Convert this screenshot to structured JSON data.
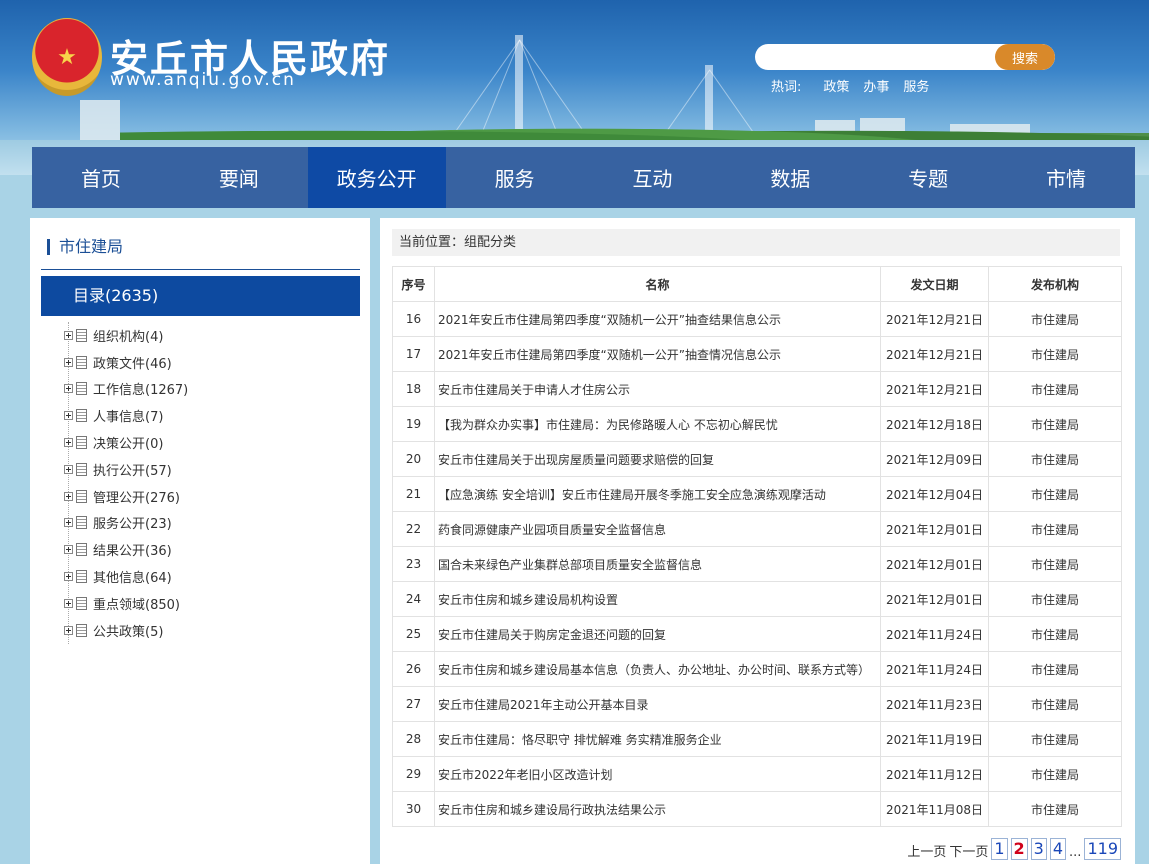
{
  "header": {
    "site_title": "安丘市人民政府",
    "site_url": "www.anqiu.gov.cn",
    "search_placeholder": "",
    "search_button": "搜索",
    "hot_label": "热词:",
    "hot_words": [
      "政策",
      "办事",
      "服务"
    ]
  },
  "nav": {
    "items": [
      "首页",
      "要闻",
      "政务公开",
      "服务",
      "互动",
      "数据",
      "专题",
      "市情"
    ],
    "active": "政务公开"
  },
  "sidebar": {
    "heading": "市住建局",
    "catalog": "目录(2635)",
    "tree": [
      "组织机构(4)",
      "政策文件(46)",
      "工作信息(1267)",
      "人事信息(7)",
      "决策公开(0)",
      "执行公开(57)",
      "管理公开(276)",
      "服务公开(23)",
      "结果公开(36)",
      "其他信息(64)",
      "重点领域(850)",
      "公共政策(5)"
    ]
  },
  "main": {
    "location": "当前位置：组配分类",
    "columns": [
      "序号",
      "名称",
      "发文日期",
      "发布机构"
    ],
    "rows": [
      {
        "num": "16",
        "title": "2021年安丘市住建局第四季度“双随机一公开”抽查结果信息公示",
        "date": "2021年12月21日",
        "org": "市住建局"
      },
      {
        "num": "17",
        "title": "2021年安丘市住建局第四季度“双随机一公开”抽查情况信息公示",
        "date": "2021年12月21日",
        "org": "市住建局"
      },
      {
        "num": "18",
        "title": "安丘市住建局关于申请人才住房公示",
        "date": "2021年12月21日",
        "org": "市住建局"
      },
      {
        "num": "19",
        "title": "【我为群众办实事】市住建局：为民修路暖人心 不忘初心解民忧",
        "date": "2021年12月18日",
        "org": "市住建局"
      },
      {
        "num": "20",
        "title": "安丘市住建局关于出现房屋质量问题要求赔偿的回复",
        "date": "2021年12月09日",
        "org": "市住建局"
      },
      {
        "num": "21",
        "title": "【应急演练 安全培训】安丘市住建局开展冬季施工安全应急演练观摩活动",
        "date": "2021年12月04日",
        "org": "市住建局"
      },
      {
        "num": "22",
        "title": "药食同源健康产业园项目质量安全监督信息",
        "date": "2021年12月01日",
        "org": "市住建局"
      },
      {
        "num": "23",
        "title": "国合未来绿色产业集群总部项目质量安全监督信息",
        "date": "2021年12月01日",
        "org": "市住建局"
      },
      {
        "num": "24",
        "title": "安丘市住房和城乡建设局机构设置",
        "date": "2021年12月01日",
        "org": "市住建局"
      },
      {
        "num": "25",
        "title": "安丘市住建局关于购房定金退还问题的回复",
        "date": "2021年11月24日",
        "org": "市住建局"
      },
      {
        "num": "26",
        "title": "安丘市住房和城乡建设局基本信息（负责人、办公地址、办公时间、联系方式等）",
        "date": "2021年11月24日",
        "org": "市住建局"
      },
      {
        "num": "27",
        "title": "安丘市住建局2021年主动公开基本目录",
        "date": "2021年11月23日",
        "org": "市住建局"
      },
      {
        "num": "28",
        "title": "安丘市住建局：恪尽职守 排忧解难 务实精准服务企业",
        "date": "2021年11月19日",
        "org": "市住建局"
      },
      {
        "num": "29",
        "title": "安丘市2022年老旧小区改造计划",
        "date": "2021年11月12日",
        "org": "市住建局"
      },
      {
        "num": "30",
        "title": "安丘市住房和城乡建设局行政执法结果公示",
        "date": "2021年11月08日",
        "org": "市住建局"
      }
    ],
    "pager": {
      "prev": "上一页",
      "next": "下一页",
      "pages": [
        "1",
        "2",
        "3",
        "4"
      ],
      "current": "2",
      "ellipsis": "...",
      "last": "119"
    }
  },
  "colors": {
    "nav_bg": "#3762a1",
    "nav_active": "#0e4aa5",
    "catalog_bg": "#0d4aa0",
    "search_button": "#d9892a",
    "page_bg": "#a9d3e6"
  },
  "icons": {
    "emblem": "national-emblem-icon",
    "tree_expand": "plus-square-icon",
    "tree_doc": "document-icon"
  }
}
